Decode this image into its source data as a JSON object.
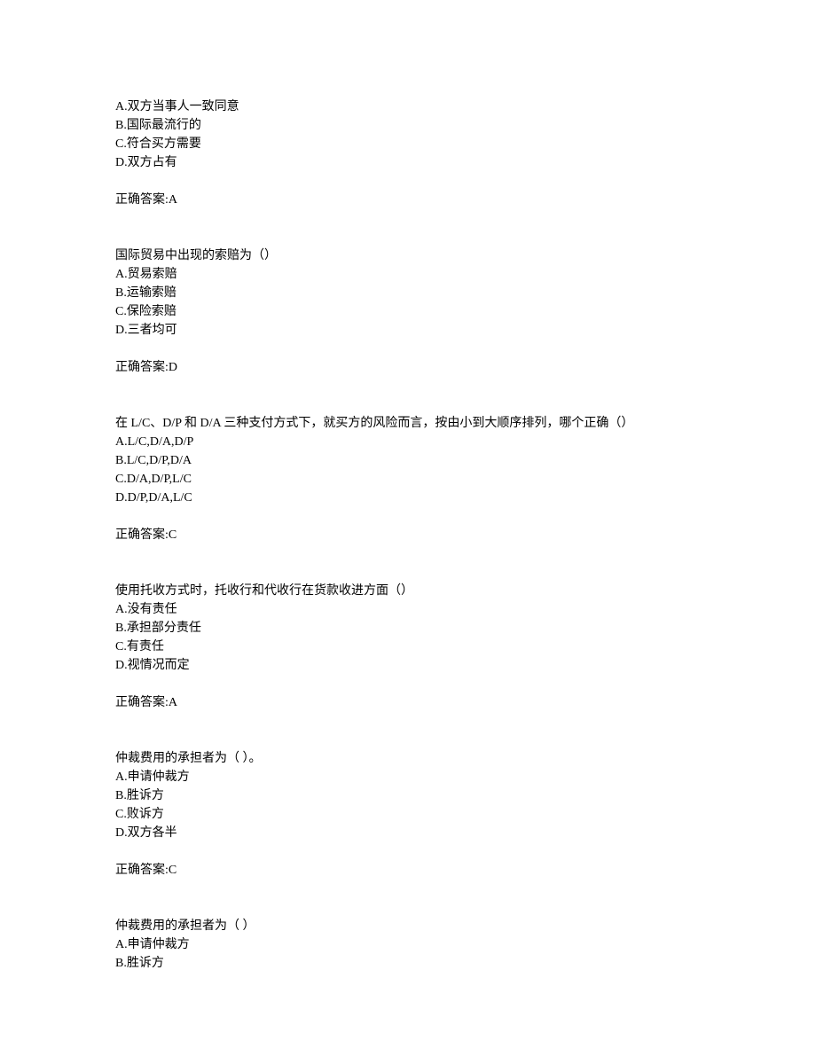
{
  "blocks": [
    {
      "options": [
        "A.双方当事人一致同意",
        "B.国际最流行的",
        "C.符合买方需要",
        "D.双方占有"
      ],
      "answer": "正确答案:A"
    },
    {
      "stem": "国际贸易中出现的索赔为（）",
      "options": [
        "A.贸易索赔",
        "B.运输索赔",
        "C.保险索赔",
        "D.三者均可"
      ],
      "answer": "正确答案:D"
    },
    {
      "stem": "在 L/C、D/P 和 D/A 三种支付方式下，就买方的风险而言，按由小到大顺序排列，哪个正确（）",
      "options": [
        "A.L/C,D/A,D/P",
        "B.L/C,D/P,D/A",
        "C.D/A,D/P,L/C",
        "D.D/P,D/A,L/C"
      ],
      "answer": "正确答案:C"
    },
    {
      "stem": "使用托收方式时，托收行和代收行在货款收进方面（）",
      "options": [
        "A.没有责任",
        "B.承担部分责任",
        "C.有责任",
        "D.视情况而定"
      ],
      "answer": "正确答案:A"
    },
    {
      "stem": "仲裁费用的承担者为（  ）。",
      "options": [
        "A.申请仲裁方",
        "B.胜诉方",
        "C.败诉方",
        "D.双方各半"
      ],
      "answer": "正确答案:C"
    },
    {
      "stem": "仲裁费用的承担者为（  ）",
      "options": [
        "A.申请仲裁方",
        "B.胜诉方"
      ]
    }
  ]
}
